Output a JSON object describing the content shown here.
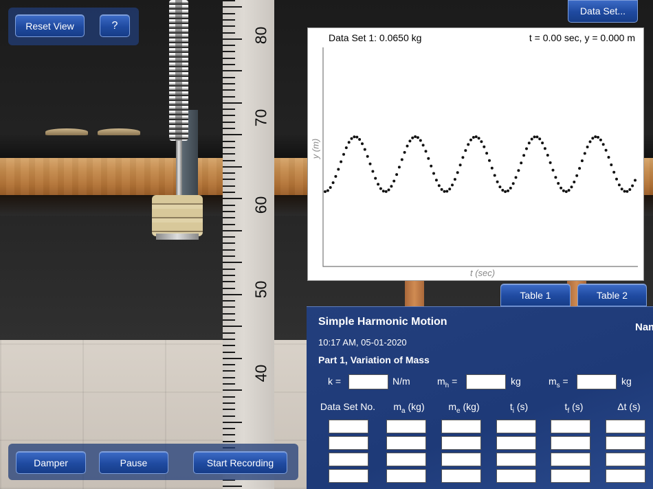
{
  "toolbar": {
    "reset_view_label": "Reset View",
    "help_label": "?",
    "data_set_label": "Data Set..."
  },
  "controls": {
    "damper_label": "Damper",
    "pause_label": "Pause",
    "start_recording_label": "Start Recording"
  },
  "ruler": {
    "labels": [
      "80",
      "70",
      "60",
      "50",
      "40"
    ]
  },
  "graph": {
    "title": "Data Set 1: 0.0650 kg",
    "readout": "t = 0.00 sec,  y = 0.000 m",
    "xlabel": "t (sec)",
    "ylabel": "y (m)"
  },
  "chart_data": {
    "type": "scatter",
    "title": "Data Set 1: 0.0650 kg",
    "xlabel": "t (sec)",
    "ylabel": "y (m)",
    "note_shape": "sinusoidal oscillation, ~5 cycles visible",
    "cycles": 5,
    "grid": false
  },
  "tabs": {
    "table1_label": "Table 1",
    "table2_label": "Table 2"
  },
  "sheet": {
    "title": "Simple Harmonic Motion",
    "name_label": "Nam",
    "timestamp": "10:17 AM, 05-01-2020",
    "part": "Part 1, Variation of Mass",
    "k_label": "k =",
    "k_unit": "N/m",
    "mh_label": "m",
    "mh_sub": "h",
    "mh_unit": "kg",
    "ms_label": "m",
    "ms_sub": "s",
    "ms_unit": "kg",
    "columns": [
      {
        "main": "Data Set No.",
        "sub": "",
        "tail": ""
      },
      {
        "main": "m",
        "sub": "a",
        "tail": " (kg)"
      },
      {
        "main": "m",
        "sub": "e",
        "tail": " (kg)"
      },
      {
        "main": "t",
        "sub": "i",
        "tail": " (s)"
      },
      {
        "main": "t",
        "sub": "f",
        "tail": " (s)"
      },
      {
        "main": "Δt (s)",
        "sub": "",
        "tail": ""
      }
    ]
  }
}
